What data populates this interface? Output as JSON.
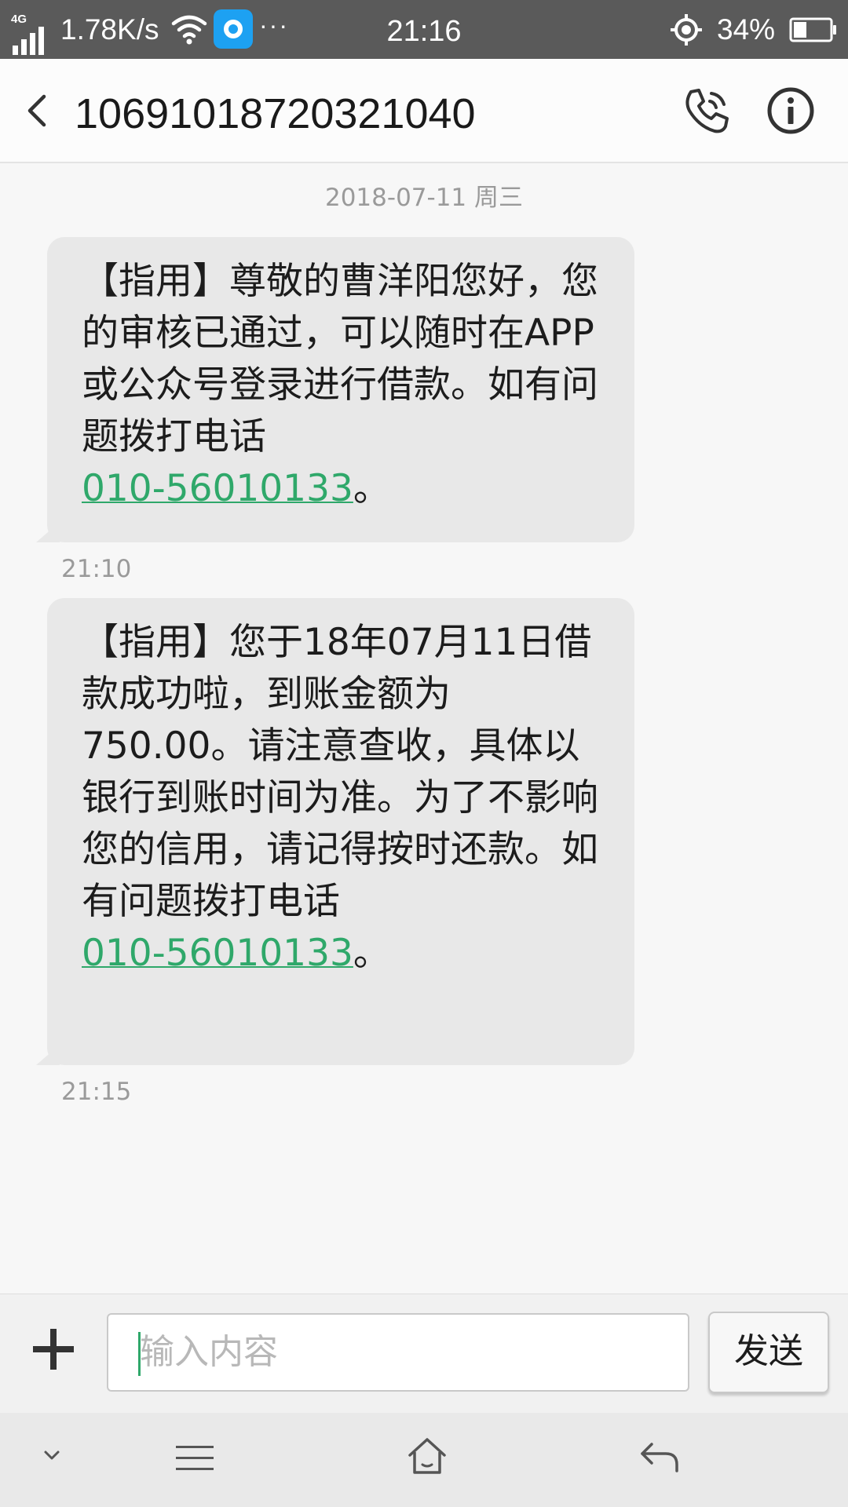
{
  "status_bar": {
    "network": "4G",
    "speed": "1.78K/s",
    "more": "···",
    "time": "21:16",
    "battery": "34%",
    "icons": [
      "signal-icon",
      "wifi-icon",
      "app-notification-icon",
      "location-icon",
      "battery-icon"
    ]
  },
  "header": {
    "title": "10691018720321040",
    "icons": [
      "back-icon",
      "phone-call-icon",
      "info-icon"
    ]
  },
  "conversation": {
    "date": "2018-07-11 周三",
    "messages": [
      {
        "text": "【指用】尊敬的曹洋阳您好，您的审核已通过，可以随时在APP或公众号登录进行借款。如有问题拨打电话",
        "phone": "010-56010133",
        "suffix": "。",
        "time": "21:10"
      },
      {
        "text": "【指用】您于18年07月11日借款成功啦，到账金额为750.00。请注意查收，具体以银行到账时间为准。为了不影响您的信用，请记得按时还款。如有问题拨打电话",
        "phone": "010-56010133",
        "suffix": "。",
        "time": "21:15"
      }
    ]
  },
  "composer": {
    "placeholder": "输入内容",
    "send_label": "发送",
    "accent_color": "#2fa86a"
  },
  "nav_bar": {
    "icons": [
      "collapse-chevron-icon",
      "menu-icon",
      "home-icon",
      "back-arrow-icon"
    ]
  },
  "colors": {
    "status_bar": "#5a5a5a",
    "bubble": "#e8e8e8",
    "link": "#2fa86a"
  }
}
